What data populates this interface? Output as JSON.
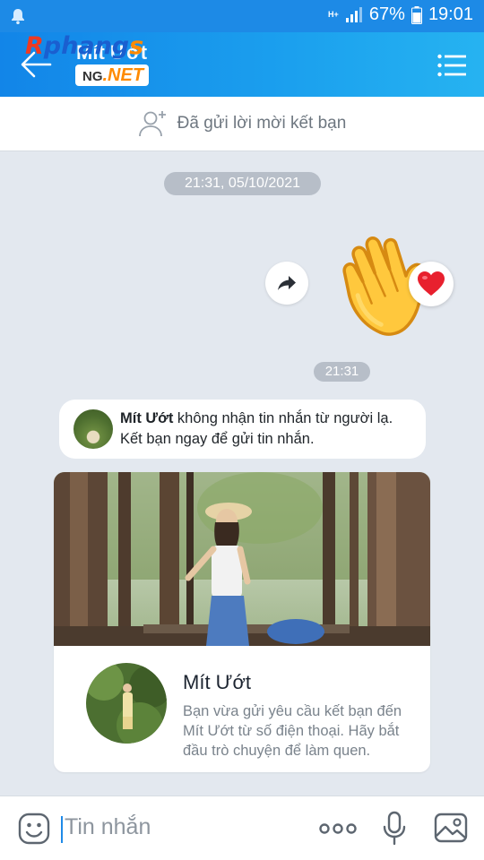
{
  "status_bar": {
    "network_label": "H+",
    "battery_percent": "67%",
    "time": "19:01"
  },
  "header": {
    "contact_name": "Mít Ướt",
    "brand_top": "Rphangs",
    "brand_top_parts": [
      "R",
      "phang",
      "s"
    ],
    "brand_bottom_prefix": "NG",
    "brand_bottom_net": ".NET",
    "background_color": "#1d8ae6"
  },
  "friend_request_bar": {
    "label": "Đã gửi lời mời kết bạn"
  },
  "chat": {
    "date_separator": "21:31, 05/10/2021",
    "message_time": "21:31",
    "sticker": "waving-hand-sticker",
    "reaction": "heart-icon",
    "notice": {
      "name": "Mít Ướt",
      "text_after_name": " không nhận tin nhắn từ người lạ.",
      "line2": "Kết bạn ngay để gửi tin nhắn."
    }
  },
  "profile_card": {
    "name": "Mít Ướt",
    "description": "Bạn vừa gửi yêu cầu kết bạn đến Mít Ướt từ số điện thoại. Hãy bắt đầu trò chuyện để làm quen."
  },
  "composer": {
    "placeholder": "Tin nhắn"
  },
  "colors": {
    "accent": "#1d8ae6",
    "background": "#e3e8ef",
    "pill": "#b7bec8",
    "heart": "#e8202e"
  }
}
